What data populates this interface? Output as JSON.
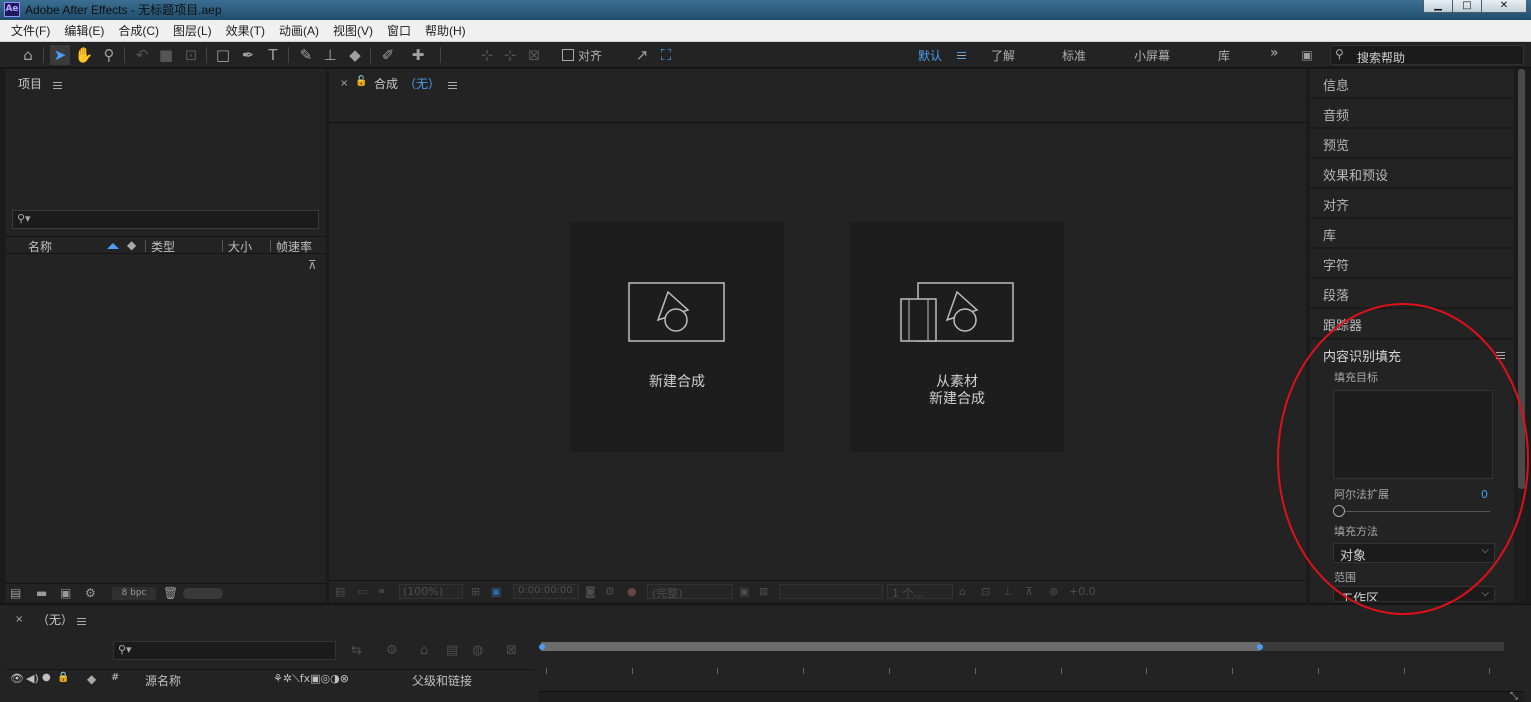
{
  "window": {
    "title": "Adobe After Effects - 无标题项目.aep",
    "app_icon": "Ae"
  },
  "menu": [
    "文件(F)",
    "编辑(E)",
    "合成(C)",
    "图层(L)",
    "效果(T)",
    "动画(A)",
    "视图(V)",
    "窗口",
    "帮助(H)"
  ],
  "toolbar": {
    "snap_label": "对齐",
    "workspaces": [
      "默认",
      "了解",
      "标准",
      "小屏幕",
      "库"
    ],
    "active_workspace": "默认",
    "more": "»",
    "help_search_placeholder": "搜索帮助"
  },
  "project_panel": {
    "title": "项目",
    "columns": [
      "名称",
      "类型",
      "大小",
      "帧速率"
    ],
    "bpc_label": "8 bpc"
  },
  "composition_panel": {
    "tab_label": "合成",
    "tab_value": "（无）",
    "new_comp_label": "新建合成",
    "from_footage_line1": "从素材",
    "from_footage_line2": "新建合成",
    "footer": {
      "zoom": "(100%)",
      "timecode": "0:00:00:00",
      "resolution": "(完整)",
      "views": "1 个...",
      "exposure": "+0.0"
    }
  },
  "right_panels": {
    "items": [
      "信息",
      "音频",
      "预览",
      "效果和预设",
      "对齐",
      "库",
      "字符",
      "段落",
      "跟踪器"
    ],
    "content_aware_fill": {
      "title": "内容识别填充",
      "fill_target_label": "填充目标",
      "alpha_expansion_label": "阿尔法扩展",
      "alpha_expansion_value": "0",
      "alpha_expansion_fraction": 0,
      "fill_method_label": "填充方法",
      "fill_method_value": "对象",
      "range_label": "范围",
      "range_value": "工作区"
    }
  },
  "timeline": {
    "title": "（无）",
    "columns": {
      "source_name": "源名称",
      "parent": "父级和链接",
      "number": "#"
    },
    "work_area_fraction": 0.747
  },
  "colors": {
    "accent": "#4a9ff5",
    "panel_bg": "#232323",
    "annotation": "#e0101a"
  }
}
